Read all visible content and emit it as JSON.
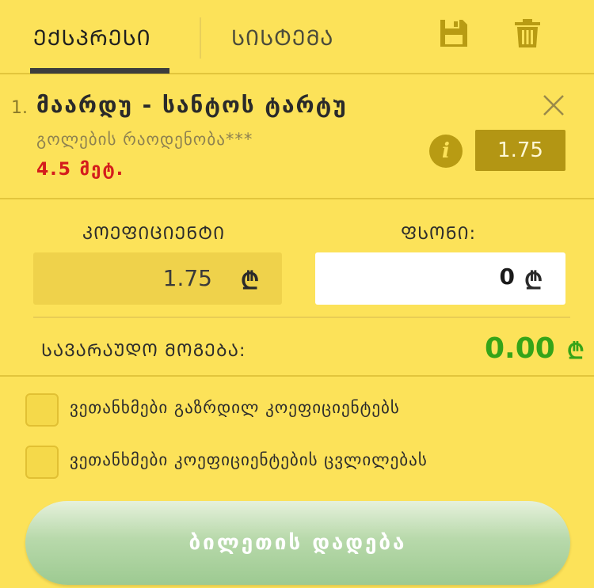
{
  "tabs": [
    {
      "label": "ᲔᲥᲡᲞᲠᲔᲡᲘ",
      "active": true
    },
    {
      "label": "ᲡᲘᲡᲢᲔᲛᲐ",
      "active": false
    }
  ],
  "toolbar": {
    "save_icon": "floppy-disk-icon",
    "delete_icon": "trash-icon"
  },
  "bet": {
    "index": "1.",
    "match": "მაარდუ - სანტოს ტარტუ",
    "market": "გოლების რაოდენობა***",
    "outcome": "4.5 მეტ.",
    "odds": "1.75",
    "remove_icon": "close-icon",
    "info_icon": "info-icon"
  },
  "coefficient": {
    "label": "ᲙᲝᲔᲤᲘᲪᲘᲔᲜᲢᲘ",
    "value": "1.75",
    "currency": "₾"
  },
  "stake": {
    "label": "ᲤᲡᲝᲜᲘ:",
    "value": "0",
    "currency": "₾"
  },
  "potential_win": {
    "label": "ᲡᲐᲕᲐᲠᲐᲣᲓᲝ ᲛᲝᲒᲔᲑᲐ:",
    "value": "0.00",
    "currency": "₾"
  },
  "options": [
    {
      "label": "ვეთანხმები გაზრდილ კოეფიციენტებს",
      "checked": false
    },
    {
      "label": "ვეთანხმები კოეფიციენტების ცვლილებას",
      "checked": false
    }
  ],
  "submit": {
    "label": "ბილეთის დადება"
  },
  "colors": {
    "background": "#fce259",
    "odds_box": "#b39614",
    "outcome": "#d41c1c",
    "win": "#35a418",
    "button": "#b8d9ab"
  }
}
